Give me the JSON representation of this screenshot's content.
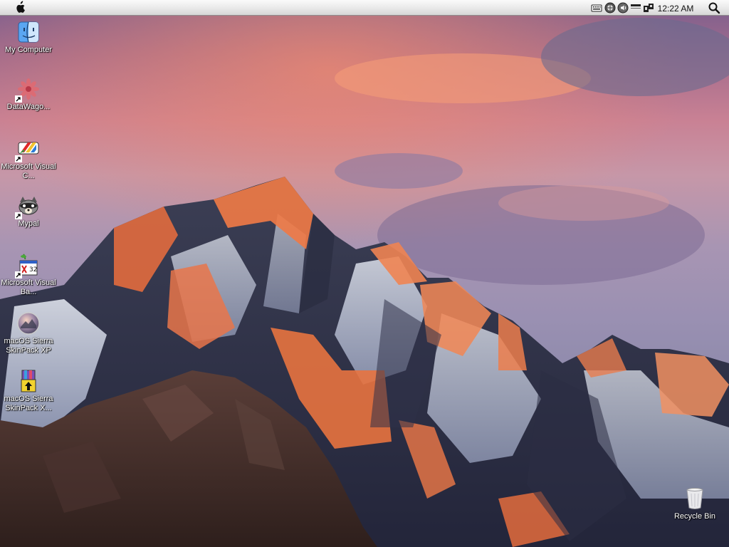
{
  "menubar": {
    "apple_icon": "apple-logo-icon",
    "tray_icons": [
      "keyboard-icon",
      "network-globe-icon",
      "volume-icon",
      "battery-icon",
      "connection-icon"
    ],
    "clock": "12:22 AM",
    "search_icon": "magnifier-icon"
  },
  "desktop": {
    "icons": [
      {
        "label": "My Computer",
        "icon": "finder-face-icon",
        "shortcut": false
      },
      {
        "label": "DataWago...",
        "icon": "flower-icon",
        "shortcut": true
      },
      {
        "label": "Microsoft Visual C...",
        "icon": "vc-pen-icon",
        "shortcut": true
      },
      {
        "label": "Mypal",
        "icon": "raccoon-icon",
        "shortcut": true
      },
      {
        "label": "Microsoft Visual Ba...",
        "icon": "vb-apple-icon",
        "shortcut": true
      },
      {
        "label": "macOS Sierra SkinPack XP",
        "icon": "sierra-orb-icon",
        "shortcut": false
      },
      {
        "label": "macOS Sierra SkinPack X...",
        "icon": "winrar-installer-icon",
        "shortcut": false
      },
      {
        "label": "Recycle Bin",
        "icon": "trash-can-icon",
        "shortcut": false
      }
    ]
  },
  "colors": {
    "label_text": "#ffffff",
    "menubar_top": "#fafafa",
    "menubar_bottom": "#d6d6d6"
  }
}
